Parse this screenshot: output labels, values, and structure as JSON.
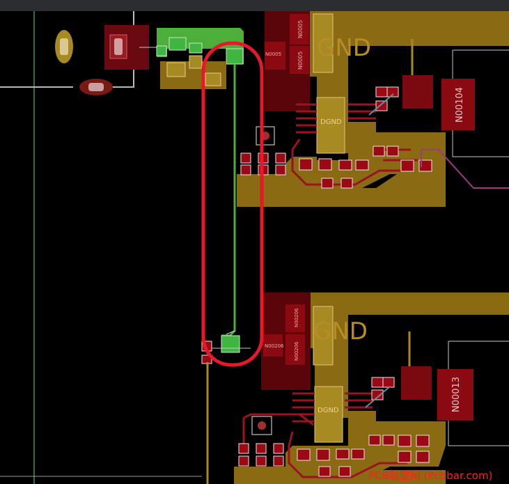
{
  "app": {
    "view": "PCB layout editor"
  },
  "labels": {
    "gnd_top": "GND",
    "gnd_bottom": "GND",
    "dgnd_top_small": "DGND",
    "dgnd_mid_top": "DGND",
    "dgnd_bottom": "DGND",
    "n0005_a": "N0005",
    "n0005_b": "N0005",
    "n0005_c": "N0005",
    "n00104": "N00104",
    "n00206_a": "N00206",
    "n00206_b": "N00206",
    "n00206_c": "N00206",
    "n00013": "N00013",
    "watermark": "PCB联盟网 (Pcbbar.com)"
  },
  "colors": {
    "background": "#000000",
    "copper_gold": "#8a6a12",
    "copper_gold_light": "#a88a22",
    "pad_red": "#8b0a12",
    "pad_red_dark": "#5a0509",
    "trace_red": "#9a1420",
    "net_green": "#4caf3a",
    "highlight_red": "#e8182a",
    "board_outline": "#b8b8b8",
    "guide_green": "#7ed67e",
    "trace_purple": "#9a3b8a",
    "watermark": "#ff2020"
  }
}
